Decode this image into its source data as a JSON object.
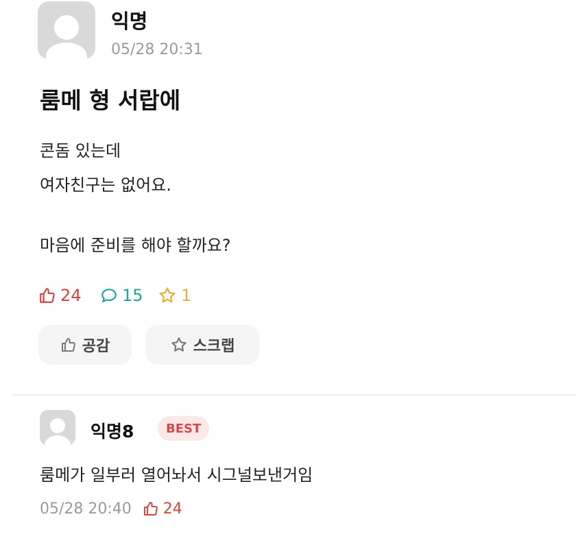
{
  "post": {
    "author": "익명",
    "time": "05/28 20:31",
    "title": "룸메 형 서랍에",
    "body_lines": [
      "콘돔 있는데",
      "여자친구는 없어요.",
      "마음에 준비를 해야 할까요?"
    ],
    "stats": {
      "likes": "24",
      "comments": "15",
      "scraps": "1"
    },
    "buttons": {
      "like_label": "공감",
      "scrap_label": "스크랩"
    }
  },
  "comment": {
    "author": "익명8",
    "badge": "BEST",
    "text": "룸메가  일부러 열어놔서 시그널보낸거임",
    "time": "05/28 20:40",
    "likes": "24"
  },
  "colors": {
    "like": "#d9443f",
    "comment": "#18a89a",
    "scrap": "#e5b33a",
    "best_bg": "#fde8e8",
    "best_text": "#d94848"
  },
  "icons": [
    "avatar-placeholder-icon",
    "thumbs-up-icon",
    "speech-bubble-icon",
    "star-icon"
  ]
}
